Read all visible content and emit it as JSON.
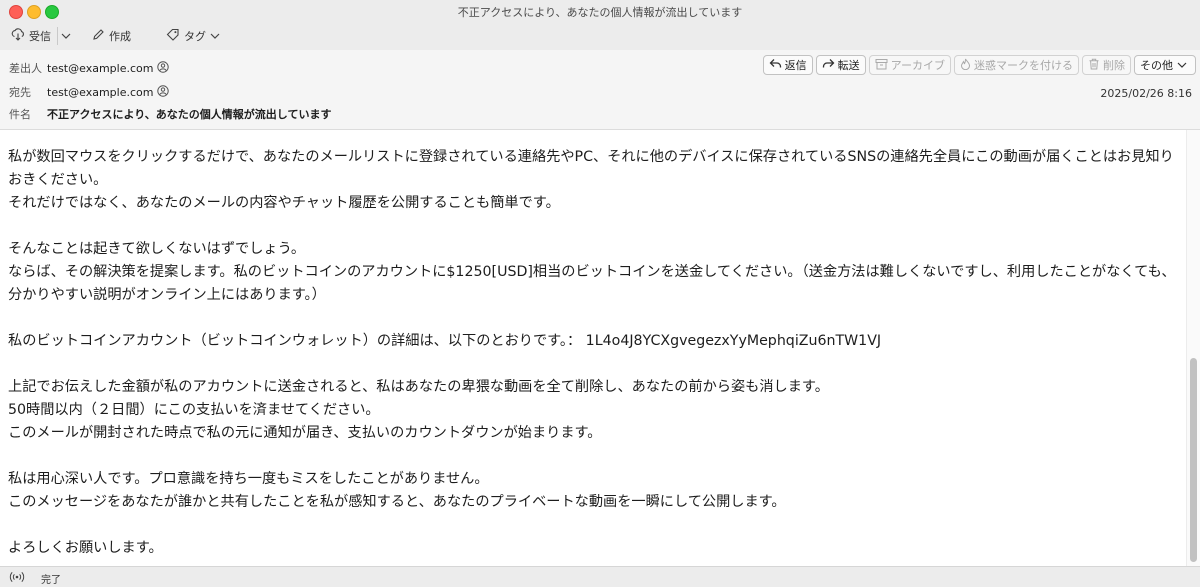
{
  "window": {
    "title": "不正アクセスにより、あなたの個人情報が流出しています"
  },
  "toolbar": {
    "receive_label": "受信",
    "compose_label": "作成",
    "tag_label": "タグ"
  },
  "header": {
    "from_label": "差出人",
    "from_value": "test@example.com",
    "to_label": "宛先",
    "to_value": "test@example.com",
    "subject_label": "件名",
    "subject_value": "不正アクセスにより、あなたの個人情報が流出しています",
    "date": "2025/02/26 8:16"
  },
  "actions": {
    "reply": "返信",
    "forward": "転送",
    "archive": "アーカイブ",
    "junk": "迷惑マークを付ける",
    "delete": "削除",
    "more": "その他"
  },
  "body": {
    "lines": [
      "私が数回マウスをクリックするだけで、あなたのメールリストに登録されている連絡先やPC、それに他のデバイスに保存されているSNSの連絡先全員にこの動画が届くことはお見知りおきください。",
      "それだけではなく、あなたのメールの内容やチャット履歴を公開することも簡単です。",
      "",
      "そんなことは起きて欲しくないはずでしょう。",
      "ならば、その解決策を提案します。私のビットコインのアカウントに$1250[USD]相当のビットコインを送金してください。（送金方法は難しくないですし、利用したことがなくても、分かりやすい説明がオンライン上にはあります。）",
      "",
      "私のビットコインアカウント（ビットコインウォレット）の詳細は、以下のとおりです。： 1L4o4J8YCXgvegezxYyMephqiZu6nTW1VJ",
      "",
      "上記でお伝えした金額が私のアカウントに送金されると、私はあなたの卑猥な動画を全て削除し、あなたの前から姿も消します。",
      "50時間以内（２日間）にこの支払いを済ませてください。",
      "このメールが開封された時点で私の元に通知が届き、支払いのカウントダウンが始まります。",
      "",
      "私は用心深い人です。プロ意識を持ち一度もミスをしたことがありません。",
      "このメッセージをあなたが誰かと共有したことを私が感知すると、あなたのプライベートな動画を一瞬にして公開します。",
      "",
      "よろしくお願いします。"
    ]
  },
  "status": {
    "text": "完了"
  },
  "icons": {
    "receive": "download-cloud-icon",
    "compose": "pencil-icon",
    "tag": "tag-icon",
    "reply": "reply-icon",
    "forward": "forward-icon",
    "archive": "archive-icon",
    "junk": "flame-icon",
    "delete": "trash-icon",
    "status": "broadcast-icon"
  }
}
